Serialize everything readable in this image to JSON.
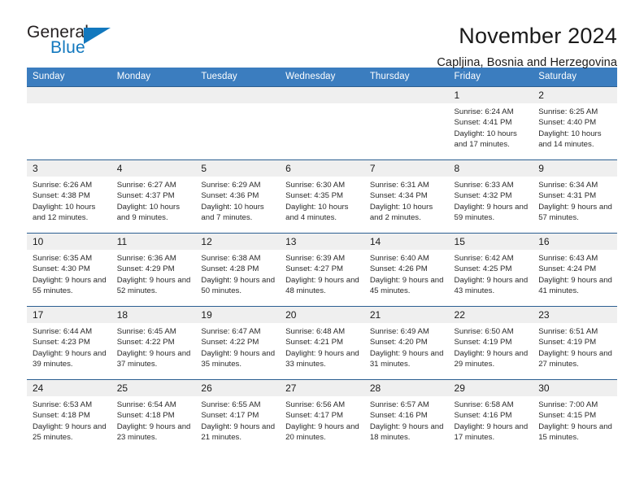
{
  "brand": {
    "name_part1": "General",
    "name_part2": "Blue",
    "triangle_color": "#1278be"
  },
  "header": {
    "title": "November 2024",
    "location": "Capljina, Bosnia and Herzegovina"
  },
  "theme": {
    "header_bg": "#3b7dbf",
    "row_border": "#2c5f92",
    "daynum_bg": "#efefef",
    "text": "#1a1a1a"
  },
  "weekdays": [
    "Sunday",
    "Monday",
    "Tuesday",
    "Wednesday",
    "Thursday",
    "Friday",
    "Saturday"
  ],
  "weeks": [
    [
      {
        "day": "",
        "blank": true
      },
      {
        "day": "",
        "blank": true
      },
      {
        "day": "",
        "blank": true
      },
      {
        "day": "",
        "blank": true
      },
      {
        "day": "",
        "blank": true
      },
      {
        "day": "1",
        "sunrise": "Sunrise: 6:24 AM",
        "sunset": "Sunset: 4:41 PM",
        "daylight": "Daylight: 10 hours and 17 minutes."
      },
      {
        "day": "2",
        "sunrise": "Sunrise: 6:25 AM",
        "sunset": "Sunset: 4:40 PM",
        "daylight": "Daylight: 10 hours and 14 minutes."
      }
    ],
    [
      {
        "day": "3",
        "sunrise": "Sunrise: 6:26 AM",
        "sunset": "Sunset: 4:38 PM",
        "daylight": "Daylight: 10 hours and 12 minutes."
      },
      {
        "day": "4",
        "sunrise": "Sunrise: 6:27 AM",
        "sunset": "Sunset: 4:37 PM",
        "daylight": "Daylight: 10 hours and 9 minutes."
      },
      {
        "day": "5",
        "sunrise": "Sunrise: 6:29 AM",
        "sunset": "Sunset: 4:36 PM",
        "daylight": "Daylight: 10 hours and 7 minutes."
      },
      {
        "day": "6",
        "sunrise": "Sunrise: 6:30 AM",
        "sunset": "Sunset: 4:35 PM",
        "daylight": "Daylight: 10 hours and 4 minutes."
      },
      {
        "day": "7",
        "sunrise": "Sunrise: 6:31 AM",
        "sunset": "Sunset: 4:34 PM",
        "daylight": "Daylight: 10 hours and 2 minutes."
      },
      {
        "day": "8",
        "sunrise": "Sunrise: 6:33 AM",
        "sunset": "Sunset: 4:32 PM",
        "daylight": "Daylight: 9 hours and 59 minutes."
      },
      {
        "day": "9",
        "sunrise": "Sunrise: 6:34 AM",
        "sunset": "Sunset: 4:31 PM",
        "daylight": "Daylight: 9 hours and 57 minutes."
      }
    ],
    [
      {
        "day": "10",
        "sunrise": "Sunrise: 6:35 AM",
        "sunset": "Sunset: 4:30 PM",
        "daylight": "Daylight: 9 hours and 55 minutes."
      },
      {
        "day": "11",
        "sunrise": "Sunrise: 6:36 AM",
        "sunset": "Sunset: 4:29 PM",
        "daylight": "Daylight: 9 hours and 52 minutes."
      },
      {
        "day": "12",
        "sunrise": "Sunrise: 6:38 AM",
        "sunset": "Sunset: 4:28 PM",
        "daylight": "Daylight: 9 hours and 50 minutes."
      },
      {
        "day": "13",
        "sunrise": "Sunrise: 6:39 AM",
        "sunset": "Sunset: 4:27 PM",
        "daylight": "Daylight: 9 hours and 48 minutes."
      },
      {
        "day": "14",
        "sunrise": "Sunrise: 6:40 AM",
        "sunset": "Sunset: 4:26 PM",
        "daylight": "Daylight: 9 hours and 45 minutes."
      },
      {
        "day": "15",
        "sunrise": "Sunrise: 6:42 AM",
        "sunset": "Sunset: 4:25 PM",
        "daylight": "Daylight: 9 hours and 43 minutes."
      },
      {
        "day": "16",
        "sunrise": "Sunrise: 6:43 AM",
        "sunset": "Sunset: 4:24 PM",
        "daylight": "Daylight: 9 hours and 41 minutes."
      }
    ],
    [
      {
        "day": "17",
        "sunrise": "Sunrise: 6:44 AM",
        "sunset": "Sunset: 4:23 PM",
        "daylight": "Daylight: 9 hours and 39 minutes."
      },
      {
        "day": "18",
        "sunrise": "Sunrise: 6:45 AM",
        "sunset": "Sunset: 4:22 PM",
        "daylight": "Daylight: 9 hours and 37 minutes."
      },
      {
        "day": "19",
        "sunrise": "Sunrise: 6:47 AM",
        "sunset": "Sunset: 4:22 PM",
        "daylight": "Daylight: 9 hours and 35 minutes."
      },
      {
        "day": "20",
        "sunrise": "Sunrise: 6:48 AM",
        "sunset": "Sunset: 4:21 PM",
        "daylight": "Daylight: 9 hours and 33 minutes."
      },
      {
        "day": "21",
        "sunrise": "Sunrise: 6:49 AM",
        "sunset": "Sunset: 4:20 PM",
        "daylight": "Daylight: 9 hours and 31 minutes."
      },
      {
        "day": "22",
        "sunrise": "Sunrise: 6:50 AM",
        "sunset": "Sunset: 4:19 PM",
        "daylight": "Daylight: 9 hours and 29 minutes."
      },
      {
        "day": "23",
        "sunrise": "Sunrise: 6:51 AM",
        "sunset": "Sunset: 4:19 PM",
        "daylight": "Daylight: 9 hours and 27 minutes."
      }
    ],
    [
      {
        "day": "24",
        "sunrise": "Sunrise: 6:53 AM",
        "sunset": "Sunset: 4:18 PM",
        "daylight": "Daylight: 9 hours and 25 minutes."
      },
      {
        "day": "25",
        "sunrise": "Sunrise: 6:54 AM",
        "sunset": "Sunset: 4:18 PM",
        "daylight": "Daylight: 9 hours and 23 minutes."
      },
      {
        "day": "26",
        "sunrise": "Sunrise: 6:55 AM",
        "sunset": "Sunset: 4:17 PM",
        "daylight": "Daylight: 9 hours and 21 minutes."
      },
      {
        "day": "27",
        "sunrise": "Sunrise: 6:56 AM",
        "sunset": "Sunset: 4:17 PM",
        "daylight": "Daylight: 9 hours and 20 minutes."
      },
      {
        "day": "28",
        "sunrise": "Sunrise: 6:57 AM",
        "sunset": "Sunset: 4:16 PM",
        "daylight": "Daylight: 9 hours and 18 minutes."
      },
      {
        "day": "29",
        "sunrise": "Sunrise: 6:58 AM",
        "sunset": "Sunset: 4:16 PM",
        "daylight": "Daylight: 9 hours and 17 minutes."
      },
      {
        "day": "30",
        "sunrise": "Sunrise: 7:00 AM",
        "sunset": "Sunset: 4:15 PM",
        "daylight": "Daylight: 9 hours and 15 minutes."
      }
    ]
  ]
}
